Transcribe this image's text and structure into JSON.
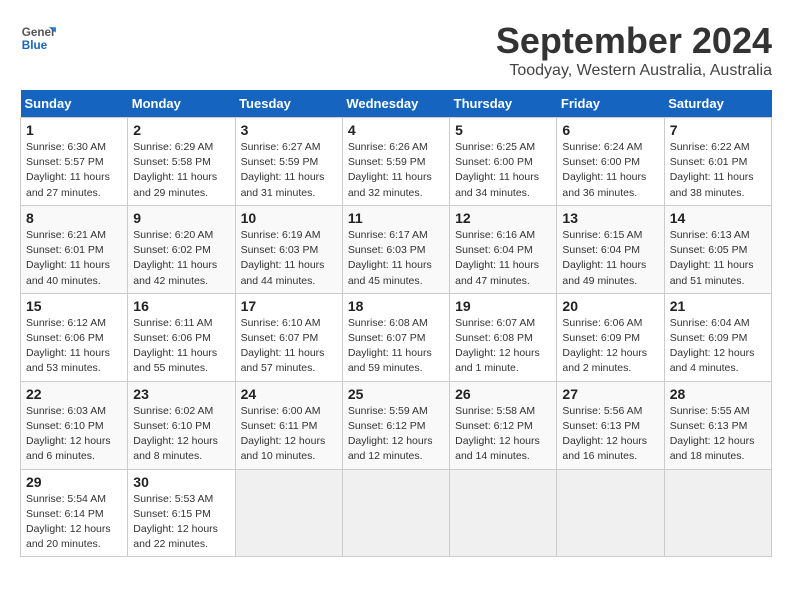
{
  "header": {
    "logo_line1": "General",
    "logo_line2": "Blue",
    "month": "September 2024",
    "location": "Toodyay, Western Australia, Australia"
  },
  "days_of_week": [
    "Sunday",
    "Monday",
    "Tuesday",
    "Wednesday",
    "Thursday",
    "Friday",
    "Saturday"
  ],
  "weeks": [
    [
      {
        "day": 1,
        "info": "Sunrise: 6:30 AM\nSunset: 5:57 PM\nDaylight: 11 hours\nand 27 minutes."
      },
      {
        "day": 2,
        "info": "Sunrise: 6:29 AM\nSunset: 5:58 PM\nDaylight: 11 hours\nand 29 minutes."
      },
      {
        "day": 3,
        "info": "Sunrise: 6:27 AM\nSunset: 5:59 PM\nDaylight: 11 hours\nand 31 minutes."
      },
      {
        "day": 4,
        "info": "Sunrise: 6:26 AM\nSunset: 5:59 PM\nDaylight: 11 hours\nand 32 minutes."
      },
      {
        "day": 5,
        "info": "Sunrise: 6:25 AM\nSunset: 6:00 PM\nDaylight: 11 hours\nand 34 minutes."
      },
      {
        "day": 6,
        "info": "Sunrise: 6:24 AM\nSunset: 6:00 PM\nDaylight: 11 hours\nand 36 minutes."
      },
      {
        "day": 7,
        "info": "Sunrise: 6:22 AM\nSunset: 6:01 PM\nDaylight: 11 hours\nand 38 minutes."
      }
    ],
    [
      {
        "day": 8,
        "info": "Sunrise: 6:21 AM\nSunset: 6:01 PM\nDaylight: 11 hours\nand 40 minutes."
      },
      {
        "day": 9,
        "info": "Sunrise: 6:20 AM\nSunset: 6:02 PM\nDaylight: 11 hours\nand 42 minutes."
      },
      {
        "day": 10,
        "info": "Sunrise: 6:19 AM\nSunset: 6:03 PM\nDaylight: 11 hours\nand 44 minutes."
      },
      {
        "day": 11,
        "info": "Sunrise: 6:17 AM\nSunset: 6:03 PM\nDaylight: 11 hours\nand 45 minutes."
      },
      {
        "day": 12,
        "info": "Sunrise: 6:16 AM\nSunset: 6:04 PM\nDaylight: 11 hours\nand 47 minutes."
      },
      {
        "day": 13,
        "info": "Sunrise: 6:15 AM\nSunset: 6:04 PM\nDaylight: 11 hours\nand 49 minutes."
      },
      {
        "day": 14,
        "info": "Sunrise: 6:13 AM\nSunset: 6:05 PM\nDaylight: 11 hours\nand 51 minutes."
      }
    ],
    [
      {
        "day": 15,
        "info": "Sunrise: 6:12 AM\nSunset: 6:06 PM\nDaylight: 11 hours\nand 53 minutes."
      },
      {
        "day": 16,
        "info": "Sunrise: 6:11 AM\nSunset: 6:06 PM\nDaylight: 11 hours\nand 55 minutes."
      },
      {
        "day": 17,
        "info": "Sunrise: 6:10 AM\nSunset: 6:07 PM\nDaylight: 11 hours\nand 57 minutes."
      },
      {
        "day": 18,
        "info": "Sunrise: 6:08 AM\nSunset: 6:07 PM\nDaylight: 11 hours\nand 59 minutes."
      },
      {
        "day": 19,
        "info": "Sunrise: 6:07 AM\nSunset: 6:08 PM\nDaylight: 12 hours\nand 1 minute."
      },
      {
        "day": 20,
        "info": "Sunrise: 6:06 AM\nSunset: 6:09 PM\nDaylight: 12 hours\nand 2 minutes."
      },
      {
        "day": 21,
        "info": "Sunrise: 6:04 AM\nSunset: 6:09 PM\nDaylight: 12 hours\nand 4 minutes."
      }
    ],
    [
      {
        "day": 22,
        "info": "Sunrise: 6:03 AM\nSunset: 6:10 PM\nDaylight: 12 hours\nand 6 minutes."
      },
      {
        "day": 23,
        "info": "Sunrise: 6:02 AM\nSunset: 6:10 PM\nDaylight: 12 hours\nand 8 minutes."
      },
      {
        "day": 24,
        "info": "Sunrise: 6:00 AM\nSunset: 6:11 PM\nDaylight: 12 hours\nand 10 minutes."
      },
      {
        "day": 25,
        "info": "Sunrise: 5:59 AM\nSunset: 6:12 PM\nDaylight: 12 hours\nand 12 minutes."
      },
      {
        "day": 26,
        "info": "Sunrise: 5:58 AM\nSunset: 6:12 PM\nDaylight: 12 hours\nand 14 minutes."
      },
      {
        "day": 27,
        "info": "Sunrise: 5:56 AM\nSunset: 6:13 PM\nDaylight: 12 hours\nand 16 minutes."
      },
      {
        "day": 28,
        "info": "Sunrise: 5:55 AM\nSunset: 6:13 PM\nDaylight: 12 hours\nand 18 minutes."
      }
    ],
    [
      {
        "day": 29,
        "info": "Sunrise: 5:54 AM\nSunset: 6:14 PM\nDaylight: 12 hours\nand 20 minutes."
      },
      {
        "day": 30,
        "info": "Sunrise: 5:53 AM\nSunset: 6:15 PM\nDaylight: 12 hours\nand 22 minutes."
      },
      null,
      null,
      null,
      null,
      null
    ]
  ]
}
